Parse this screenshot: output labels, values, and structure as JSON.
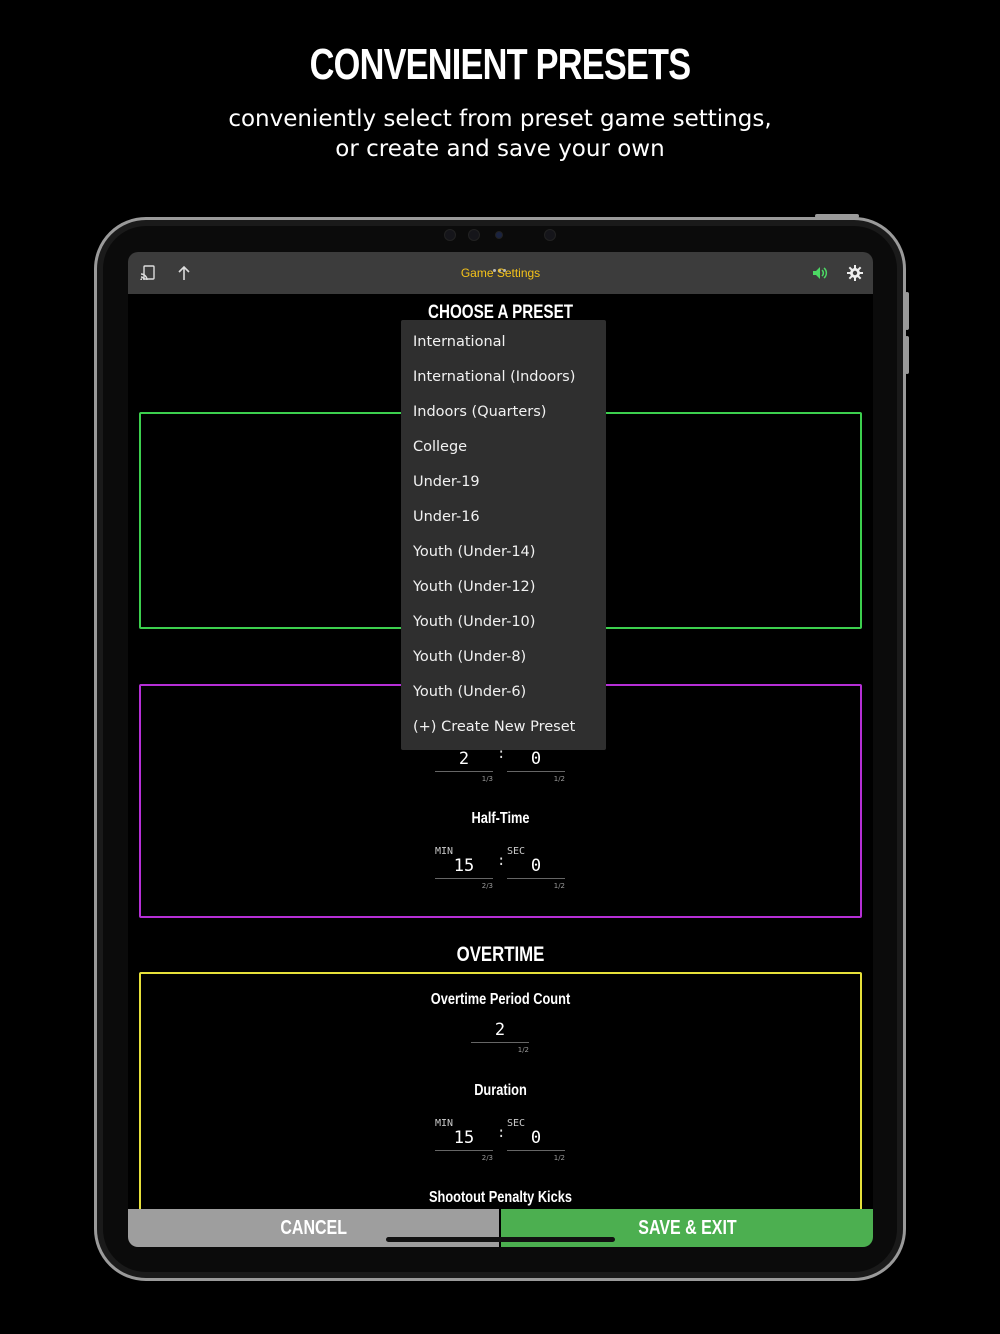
{
  "hero": {
    "title": "CONVENIENT PRESETS",
    "subtitle_line1": "conveniently select from preset game settings,",
    "subtitle_line2": "or create and save your own"
  },
  "topbar": {
    "title": "Game Settings",
    "left_icons": [
      "cast-icon",
      "share-arrow-icon"
    ],
    "right_icons": [
      "speaker-icon",
      "gear-icon"
    ],
    "title_color": "#f4c21a",
    "speaker_color": "#4cd964"
  },
  "preset_section": {
    "heading": "CHOOSE A PRESET"
  },
  "dropdown": {
    "items": [
      "International",
      "International (Indoors)",
      "Indoors (Quarters)",
      "College",
      "Under-19",
      "Under-16",
      "Youth (Under-14)",
      "Youth (Under-12)",
      "Youth (Under-10)",
      "Youth (Under-8)",
      "Youth (Under-6)",
      "(+) Create New Preset"
    ]
  },
  "colors": {
    "green_box": "#3ccf4e",
    "purple_box": "#b52fd6",
    "yellow_box": "#e6e03a",
    "save_button": "#4caf50",
    "cancel_button": "#9e9e9e"
  },
  "period_box": {
    "row_min_value": "2",
    "row_min_limit": "1/3",
    "row_sec_value": "0",
    "row_sec_limit": "1/2"
  },
  "halftime": {
    "label": "Half-Time",
    "min_unit": "MIN",
    "sec_unit": "SEC",
    "min_value": "15",
    "min_limit": "2/3",
    "sec_value": "0",
    "sec_limit": "1/2"
  },
  "overtime": {
    "heading": "OVERTIME",
    "period_count_label": "Overtime Period Count",
    "period_count_value": "2",
    "period_count_limit": "1/2",
    "duration_label": "Duration",
    "min_unit": "MIN",
    "sec_unit": "SEC",
    "min_value": "15",
    "min_limit": "2/3",
    "sec_value": "0",
    "sec_limit": "1/2",
    "shootout_label": "Shootout Penalty Kicks"
  },
  "footer": {
    "cancel_label": "CANCEL",
    "save_label": "SAVE & EXIT"
  }
}
